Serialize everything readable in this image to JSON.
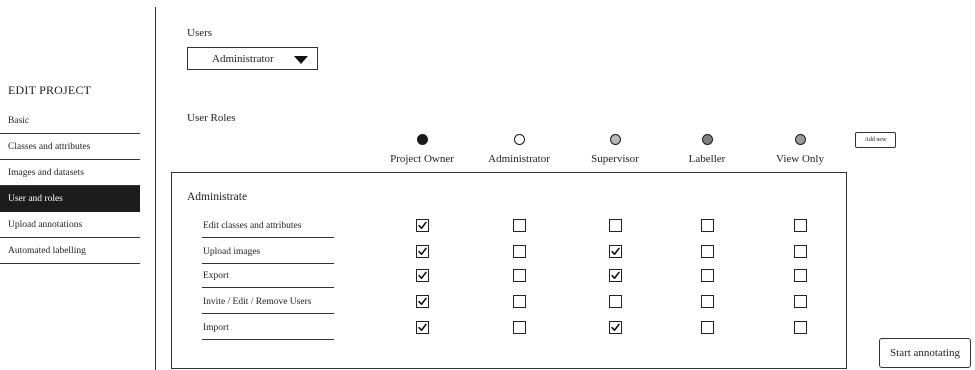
{
  "sidebar": {
    "title": "EDIT PROJECT",
    "items": [
      {
        "label": "Basic",
        "active": false
      },
      {
        "label": "Classes and attributes",
        "active": false
      },
      {
        "label": "Images and datasets",
        "active": false
      },
      {
        "label": "User and roles",
        "active": true
      },
      {
        "label": "Upload annotations",
        "active": false
      },
      {
        "label": "Automated labelling",
        "active": false
      }
    ]
  },
  "users": {
    "label": "Users",
    "selected_role": "Administrator"
  },
  "user_roles": {
    "label": "User Roles",
    "add_new_label": "Add new",
    "roles": [
      {
        "name": "Project Owner",
        "color": "#1a1a1a"
      },
      {
        "name": "Administrator",
        "color": "#ffffff"
      },
      {
        "name": "Supervisor",
        "color": "#b8b8b8"
      },
      {
        "name": "Labeller",
        "color": "#808080"
      },
      {
        "name": "View Only",
        "color": "#9a9a9a"
      }
    ]
  },
  "permissions": {
    "section_title": "Administrate",
    "rows": [
      {
        "label": "Edit classes and attributes",
        "checks": [
          true,
          false,
          false,
          false,
          false
        ]
      },
      {
        "label": "Upload images",
        "checks": [
          true,
          false,
          true,
          false,
          false
        ]
      },
      {
        "label": "Export",
        "checks": [
          true,
          false,
          true,
          false,
          false
        ]
      },
      {
        "label": "Invite / Edit / Remove Users",
        "checks": [
          true,
          false,
          false,
          false,
          false
        ]
      },
      {
        "label": "Import",
        "checks": [
          true,
          false,
          true,
          false,
          false
        ]
      }
    ]
  },
  "actions": {
    "start_label": "Start annotating"
  }
}
